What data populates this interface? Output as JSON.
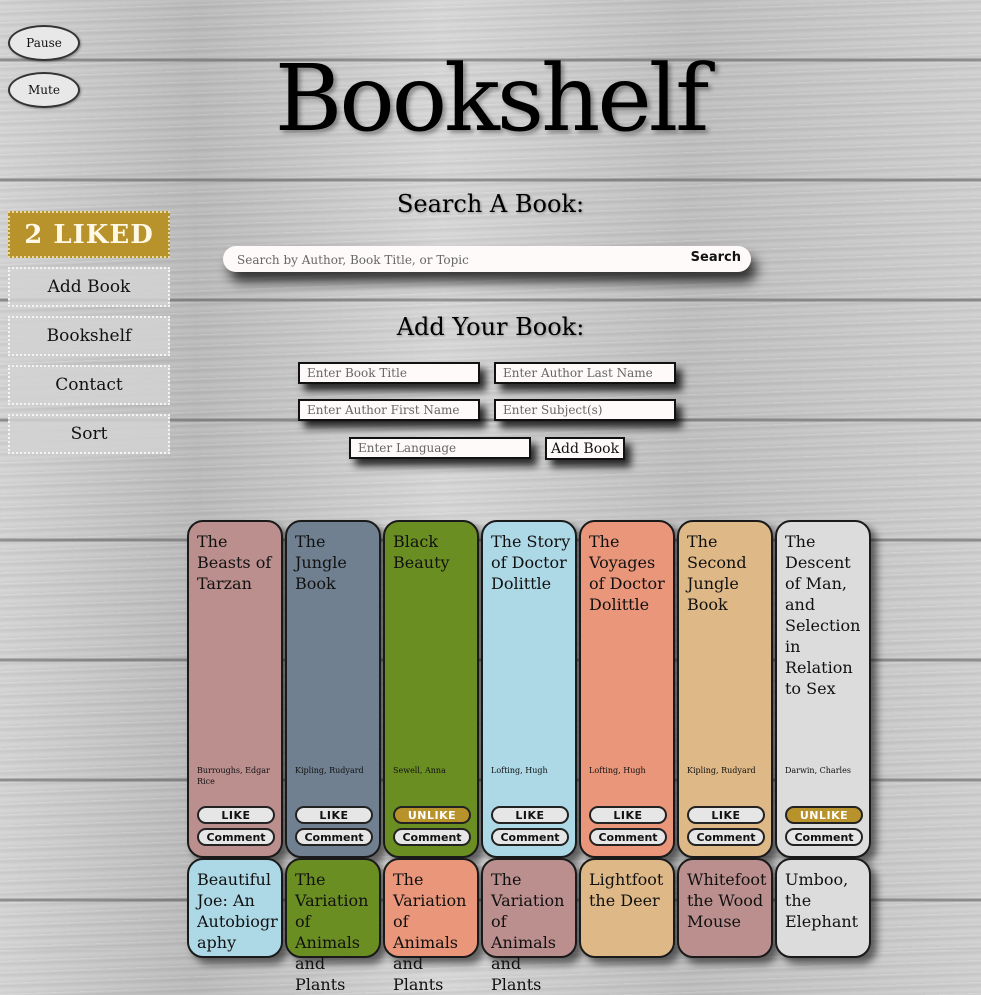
{
  "controls": {
    "pause_label": "Pause",
    "mute_label": "Mute"
  },
  "header": {
    "title": "Bookshelf"
  },
  "sidebar": {
    "liked_label": "2 LIKED",
    "items": [
      {
        "label": "Add Book"
      },
      {
        "label": "Bookshelf"
      },
      {
        "label": "Contact"
      },
      {
        "label": "Sort"
      }
    ]
  },
  "search": {
    "heading": "Search A Book:",
    "placeholder": "Search by Author, Book Title, or Topic",
    "button_label": "Search"
  },
  "add_book": {
    "heading": "Add Your Book:",
    "title_placeholder": "Enter Book Title",
    "author_last_placeholder": "Enter Author Last Name",
    "author_first_placeholder": "Enter Author First Name",
    "subject_placeholder": "Enter Subject(s)",
    "language_placeholder": "Enter Language",
    "button_label": "Add Book"
  },
  "colors": {
    "accent_gold": "#b8922a",
    "book_rosybrown": "#bc8f8f",
    "book_slategray": "#708090",
    "book_olivedrab": "#6b8e23",
    "book_lightblue": "#add8e6",
    "book_darksalmon": "#e9967a",
    "book_burlywood": "#deb887",
    "book_gainsboro": "#dcdcdc"
  },
  "books_row1": [
    {
      "title": "The Beasts of Tarzan",
      "author": "Burroughs, Edgar Rice",
      "like": "LIKE",
      "comment": "Comment",
      "color": "#bc8f8f"
    },
    {
      "title": "The Jungle Book",
      "author": "Kipling, Rudyard",
      "like": "LIKE",
      "comment": "Comment",
      "color": "#708090"
    },
    {
      "title": "Black Beauty",
      "author": "Sewell, Anna",
      "like": "UNLIKE",
      "comment": "Comment",
      "color": "#6b8e23"
    },
    {
      "title": "The Story of Doctor Dolittle",
      "author": "Lofting, Hugh",
      "like": "LIKE",
      "comment": "Comment",
      "color": "#add8e6"
    },
    {
      "title": "The Voyages of Doctor Dolittle",
      "author": "Lofting, Hugh",
      "like": "LIKE",
      "comment": "Comment",
      "color": "#e9967a"
    },
    {
      "title": "The Second Jungle Book",
      "author": "Kipling, Rudyard",
      "like": "LIKE",
      "comment": "Comment",
      "color": "#deb887"
    },
    {
      "title": "The Descent of Man, and Selection in Relation to Sex",
      "author": "Darwin, Charles",
      "like": "UNLIKE",
      "comment": "Comment",
      "color": "#dcdcdc"
    }
  ],
  "books_row2": [
    {
      "title": "Beautiful Joe: An Autobiography",
      "color": "#add8e6"
    },
    {
      "title": "The Variation of Animals and Plants",
      "color": "#6b8e23"
    },
    {
      "title": "The Variation of Animals and Plants",
      "color": "#e9967a"
    },
    {
      "title": "The Variation of Animals and Plants",
      "color": "#bc8f8f"
    },
    {
      "title": "Lightfoot the Deer",
      "color": "#deb887"
    },
    {
      "title": "Whitefoot the Wood Mouse",
      "color": "#bc8f8f"
    },
    {
      "title": "Umboo, the Elephant",
      "color": "#dcdcdc"
    }
  ]
}
